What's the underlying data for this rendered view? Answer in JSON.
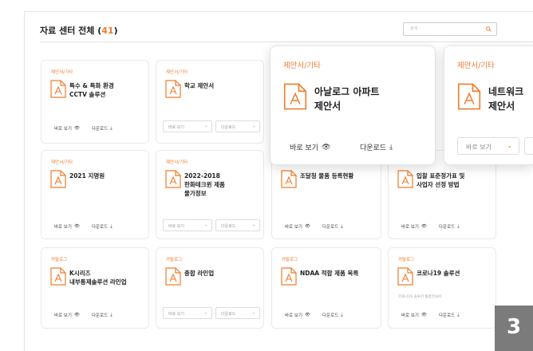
{
  "header": {
    "title": "자료 센터 전체",
    "count": "41"
  },
  "search": {
    "placeholder": "검색"
  },
  "labels": {
    "view": "바로 보기",
    "download": "다운로드"
  },
  "colors": {
    "accent": "#f07c2c",
    "badge": "#7b7b7b"
  },
  "cards": [
    {
      "category": "제안서/기타",
      "title_lines": [
        "특수 & 특화 환경",
        "CCTV 솔루션"
      ],
      "buttons": "inline"
    },
    {
      "category": "제안서/기타",
      "title_lines": [
        "학교 제안서"
      ],
      "buttons": "select"
    },
    {
      "category": "제안서/기타",
      "title_lines": [
        "2021 지명원"
      ],
      "buttons": "inline"
    },
    {
      "category": "제안서/기타",
      "title_lines": [
        "2022-2018",
        "한화테크윈 제품",
        "물가정보"
      ],
      "buttons": "select"
    },
    {
      "category": "",
      "title_lines": [
        "조달청 물품 등록현황"
      ],
      "buttons": "inline"
    },
    {
      "category": "",
      "title_lines": [
        "입찰 표준정가표 및",
        "사업자 선정 방법"
      ],
      "buttons": "inline"
    },
    {
      "category": "카탈로그",
      "title_lines": [
        "K시리즈",
        "내부통제솔루션 라인업"
      ],
      "buttons": "inline"
    },
    {
      "category": "카탈로그",
      "title_lines": [
        "종합 라인업"
      ],
      "buttons": "select"
    },
    {
      "category": "카탈로그",
      "title_lines": [
        "NDAA 적합 제품 목록"
      ],
      "buttons": "inline"
    },
    {
      "category": "카탈로그",
      "title_lines": [
        "코로나19 솔루션"
      ],
      "subtitle": "코로나19 솔루션 통합안내서",
      "buttons": "inline"
    }
  ],
  "big_cards": [
    {
      "category": "제안서/기타",
      "title_lines": [
        "아날로그 아파트",
        "제안서"
      ]
    },
    {
      "category": "제안서/기타",
      "title_lines": [
        "네트워크",
        "제안서"
      ]
    }
  ],
  "badge": "3"
}
